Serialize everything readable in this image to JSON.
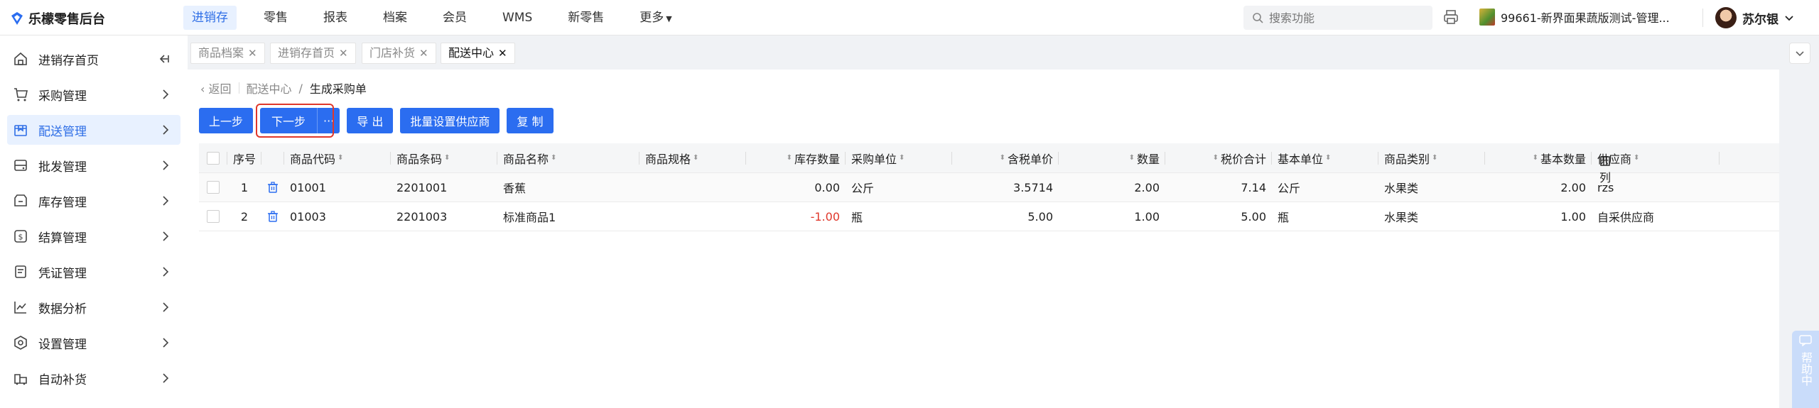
{
  "app": {
    "title": "乐檬零售后台"
  },
  "topnav": [
    {
      "label": "进销存",
      "active": true
    },
    {
      "label": "零售",
      "active": false
    },
    {
      "label": "报表",
      "active": false
    },
    {
      "label": "档案",
      "active": false
    },
    {
      "label": "会员",
      "active": false
    },
    {
      "label": "WMS",
      "active": false
    },
    {
      "label": "新零售",
      "active": false
    },
    {
      "label": "更多",
      "active": false
    }
  ],
  "search": {
    "placeholder": "搜索功能"
  },
  "store": {
    "name": "99661-新界面果蔬版测试-管理..."
  },
  "user": {
    "name": "苏尔银"
  },
  "sidebar": {
    "items": [
      {
        "label": "进销存首页",
        "icon": "home-icon"
      },
      {
        "label": "采购管理",
        "icon": "cart-icon"
      },
      {
        "label": "配送管理",
        "icon": "delivery-icon",
        "active": true
      },
      {
        "label": "批发管理",
        "icon": "wholesale-icon"
      },
      {
        "label": "库存管理",
        "icon": "inventory-icon"
      },
      {
        "label": "结算管理",
        "icon": "settlement-icon"
      },
      {
        "label": "凭证管理",
        "icon": "voucher-icon"
      },
      {
        "label": "数据分析",
        "icon": "chart-icon"
      },
      {
        "label": "设置管理",
        "icon": "settings-icon"
      },
      {
        "label": "自动补货",
        "icon": "replenish-icon"
      }
    ]
  },
  "tabs": [
    {
      "label": "商品档案",
      "active": false
    },
    {
      "label": "进销存首页",
      "active": false
    },
    {
      "label": "门店补货",
      "active": false
    },
    {
      "label": "配送中心",
      "active": true
    }
  ],
  "breadcrumb": {
    "back": "返回",
    "parent": "配送中心",
    "separator": "/",
    "current": "生成采购单"
  },
  "toolbar": {
    "prev": "上一步",
    "next": "下一步",
    "more": "···",
    "export": "导 出",
    "batch_supplier": "批量设置供应商",
    "copy": "复 制"
  },
  "table": {
    "columns": [
      "序号",
      "商品代码",
      "商品条码",
      "商品名称",
      "商品规格",
      "库存数量",
      "采购单位",
      "含税单价",
      "数量",
      "税价合计",
      "基本单位",
      "商品类别",
      "基本数量",
      "供应商"
    ],
    "rows": [
      {
        "no": "1",
        "code": "01001",
        "barcode": "2201001",
        "name": "香蕉",
        "spec": "",
        "stock": "0.00",
        "unit": "公斤",
        "price": "3.5714",
        "qty": "2.00",
        "total": "7.14",
        "base_unit": "公斤",
        "category": "水果类",
        "base_qty": "2.00",
        "supplier": "rzs",
        "stock_negative": false
      },
      {
        "no": "2",
        "code": "01003",
        "barcode": "2201003",
        "name": "标准商品1",
        "spec": "",
        "stock": "-1.00",
        "unit": "瓶",
        "price": "5.00",
        "qty": "1.00",
        "total": "5.00",
        "base_unit": "瓶",
        "category": "水果类",
        "base_qty": "1.00",
        "supplier": "自采供应商",
        "stock_negative": true
      }
    ]
  },
  "column_setting": {
    "label": "列"
  },
  "help": {
    "label": "帮助中"
  },
  "colors": {
    "primary": "#2b6df0",
    "highlight": "#e0372b",
    "negative": "#e0372b"
  }
}
